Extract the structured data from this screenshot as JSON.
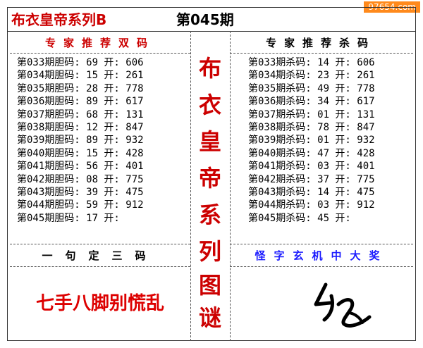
{
  "header": {
    "title": "布衣皇帝系列B",
    "issue": "第045期",
    "watermark": "97654.com"
  },
  "left_panel": {
    "heading": "专家推荐双码",
    "rows": [
      "第033期胆码: 69 开: 606",
      "第034期胆码: 15 开: 261",
      "第035期胆码: 28 开: 778",
      "第036期胆码: 89 开: 617",
      "第037期胆码: 68 开: 131",
      "第038期胆码: 12 开: 847",
      "第039期胆码: 89 开: 932",
      "第040期胆码: 15 开: 428",
      "第041期胆码: 56 开: 401",
      "第042期胆码: 08 开: 775",
      "第043期胆码: 39 开: 475",
      "第044期胆码: 59 开: 912",
      "第045期胆码: 17 开:"
    ],
    "bottom_heading": "一句定三码",
    "bottom_phrase": "七手八脚别慌乱"
  },
  "right_panel": {
    "heading": "专家推荐杀码",
    "rows": [
      "第033期杀码: 14 开: 606",
      "第034期杀码: 23 开: 261",
      "第035期杀码: 49 开: 778",
      "第036期杀码: 34 开: 617",
      "第037期杀码: 01 开: 131",
      "第038期杀码: 78 开: 847",
      "第039期杀码: 01 开: 932",
      "第040期杀码: 47 开: 428",
      "第041期杀码: 03 开: 401",
      "第042期杀码: 37 开: 775",
      "第043期杀码: 14 开: 475",
      "第044期杀码: 03 开: 912",
      "第045期杀码: 45 开:"
    ],
    "bottom_heading": "怪字玄机中大奖"
  },
  "center_strip": [
    "布",
    "衣",
    "皇",
    "帝",
    "系",
    "列",
    "图",
    "谜"
  ],
  "colors": {
    "accent_red": "#cc0000",
    "accent_blue": "#1a1aff",
    "border": "#333333"
  }
}
